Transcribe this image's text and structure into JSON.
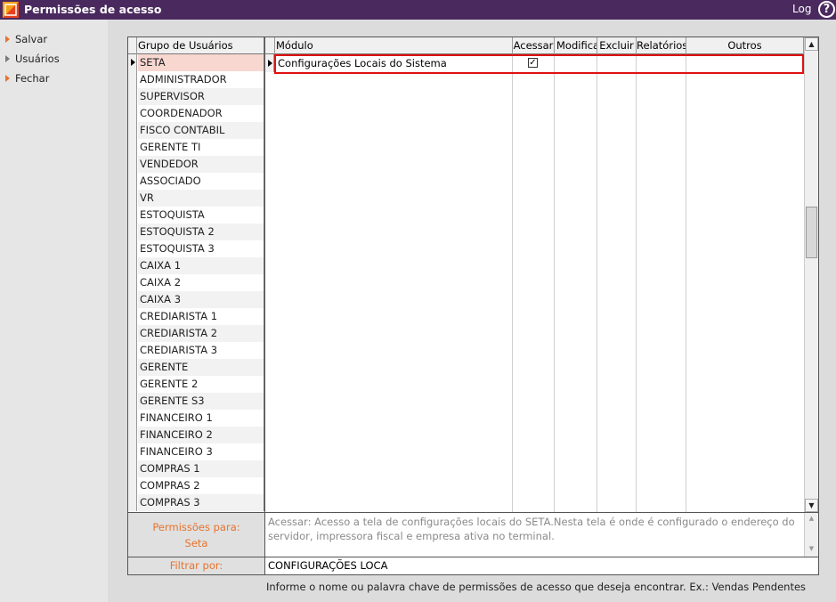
{
  "window": {
    "title": "Permissões de acesso",
    "log_label": "Log",
    "help_icon": "help-icon",
    "help_glyph": "?"
  },
  "sidebar": {
    "items": [
      {
        "label": "Salvar",
        "icon": "arrow-right-icon",
        "color": "#e8732c"
      },
      {
        "label": "Usuários",
        "icon": "arrow-right-icon",
        "color": "#7a7a7a"
      },
      {
        "label": "Fechar",
        "icon": "arrow-right-icon",
        "color": "#e8732c"
      }
    ]
  },
  "groups": {
    "header": "Grupo de Usuários",
    "selected_index": 0,
    "items": [
      "SETA",
      "ADMINISTRADOR",
      "SUPERVISOR",
      "COORDENADOR",
      "FISCO CONTABIL",
      "GERENTE TI",
      "VENDEDOR",
      "ASSOCIADO",
      "VR",
      "ESTOQUISTA",
      "ESTOQUISTA 2",
      "ESTOQUISTA 3",
      "CAIXA 1",
      "CAIXA 2",
      "CAIXA 3",
      "CREDIARISTA 1",
      "CREDIARISTA 2",
      "CREDIARISTA 3",
      "GERENTE",
      "GERENTE 2",
      "GERENTE S3",
      "FINANCEIRO 1",
      "FINANCEIRO 2",
      "FINANCEIRO 3",
      "COMPRAS 1",
      "COMPRAS 2",
      "COMPRAS 3"
    ]
  },
  "modules": {
    "headers": {
      "module": "Módulo",
      "access": "Acessar",
      "modify": "Modifica",
      "delete": "Excluir",
      "reports": "Relatórios",
      "others": "Outros"
    },
    "rows": [
      {
        "name": "Configurações Locais do Sistema",
        "access": true,
        "highlight_color": "#e01010"
      }
    ],
    "check_glyph": "✓"
  },
  "scroll_arrows": {
    "up": "▲",
    "down": "▼"
  },
  "permissions": {
    "label": "Permissões para:",
    "group": "Seta",
    "description": "Acessar: Acesso a tela de configurações locais do SETA.Nesta tela é onde é configurado o endereço do servidor, impressora fiscal  e empresa ativa no terminal."
  },
  "filter": {
    "label": "Filtrar por:",
    "value": "CONFIGURAÇÕES LOCA",
    "hint": "Informe o nome ou palavra chave de permissões de acesso que deseja encontrar. Ex.: Vendas Pendentes"
  },
  "colors": {
    "titlebar": "#4a2a5e",
    "accent": "#e8732c",
    "selected_row": "#f8d7d0"
  }
}
